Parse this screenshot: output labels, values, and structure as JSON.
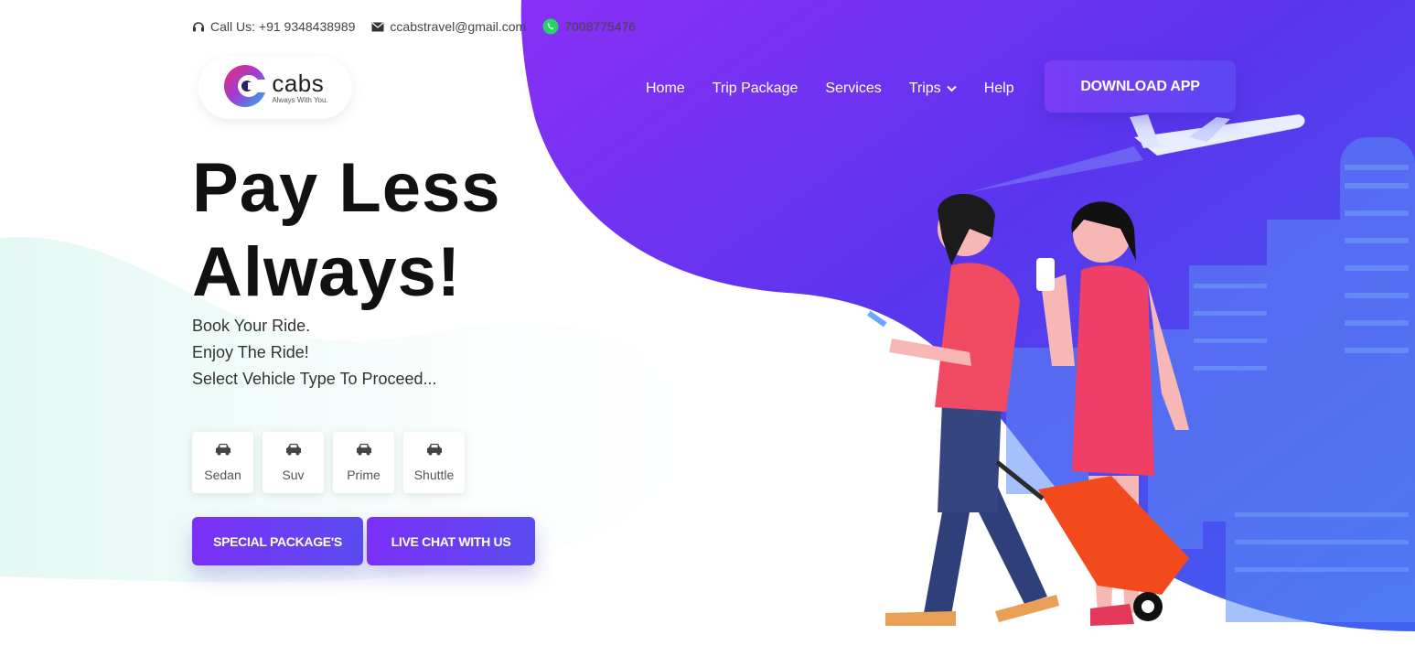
{
  "topbar": {
    "call": "Call Us: +91 9348438989",
    "email": "ccabstravel@gmail.com",
    "whatsapp": "7008775476"
  },
  "logo": {
    "name": "cabs",
    "tagline": "Always With You."
  },
  "nav": {
    "items": [
      "Home",
      "Trip Package",
      "Services",
      "Trips",
      "Help"
    ],
    "download": "DOWNLOAD APP"
  },
  "hero": {
    "title_line1": "Pay Less",
    "title_line2": "Always!",
    "lines": [
      "Book Your Ride.",
      "Enjoy The Ride!",
      "Select Vehicle Type To Proceed..."
    ]
  },
  "vehicles": [
    "Sedan",
    "Suv",
    "Prime",
    "Shuttle"
  ],
  "ctas": {
    "special": "SPECIAL PACKAGE'S",
    "chat": "LIVE CHAT WITH US"
  },
  "colors": {
    "accent_purple": "#7b2ff7",
    "accent_blue": "#4f5cf0",
    "whatsapp_green": "#25d366"
  }
}
